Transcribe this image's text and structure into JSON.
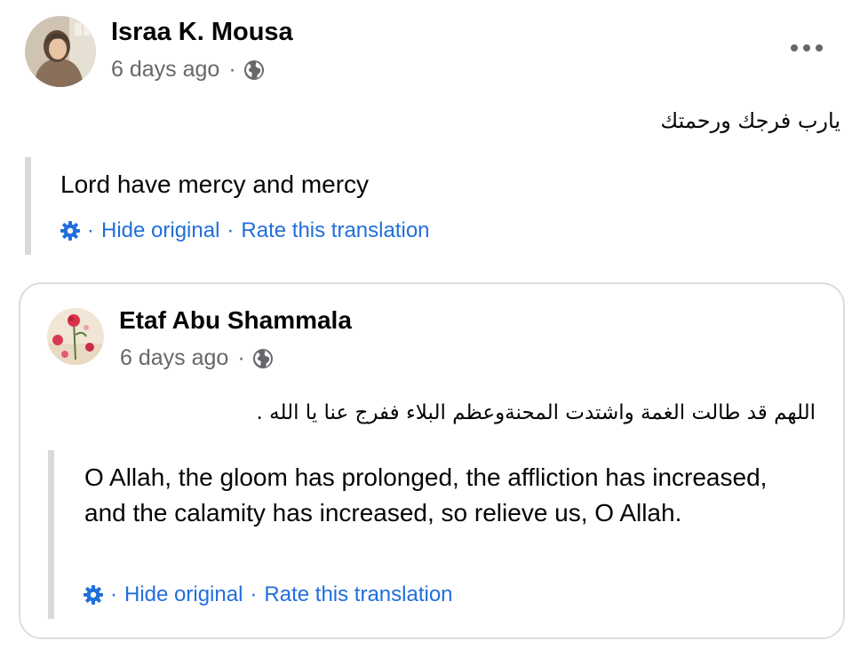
{
  "post": {
    "author": "Israa K. Mousa",
    "time": "6 days ago",
    "separator": "·",
    "original_text": "يارب فرجك ورحمتك",
    "translation": "Lord have mercy and mercy",
    "actions": {
      "sep": "·",
      "hide_original": "Hide original",
      "rate_translation": "Rate this translation"
    },
    "icons": {
      "avatar": "profile-photo",
      "privacy": "globe-icon",
      "more": "more-options-icon",
      "settings": "gear-icon"
    }
  },
  "comment": {
    "author": "Etaf Abu Shammala",
    "time": "6 days ago",
    "separator": "·",
    "original_text": "اللهم قد طالت الغمة واشتدت المحنةوعظم البلاء ففرج عنا يا الله .",
    "translation": "O Allah, the gloom has prolonged, the affliction has increased, and the calamity has increased, so relieve us, O Allah.",
    "actions": {
      "sep": "·",
      "hide_original": "Hide original",
      "rate_translation": "Rate this translation"
    },
    "icons": {
      "avatar": "profile-photo-flowers",
      "privacy": "globe-icon",
      "settings": "gear-icon"
    }
  },
  "colors": {
    "link": "#216fdb",
    "meta_text": "#65676b",
    "quote_bar": "#d7d9dd",
    "card_border": "#dadde1"
  }
}
